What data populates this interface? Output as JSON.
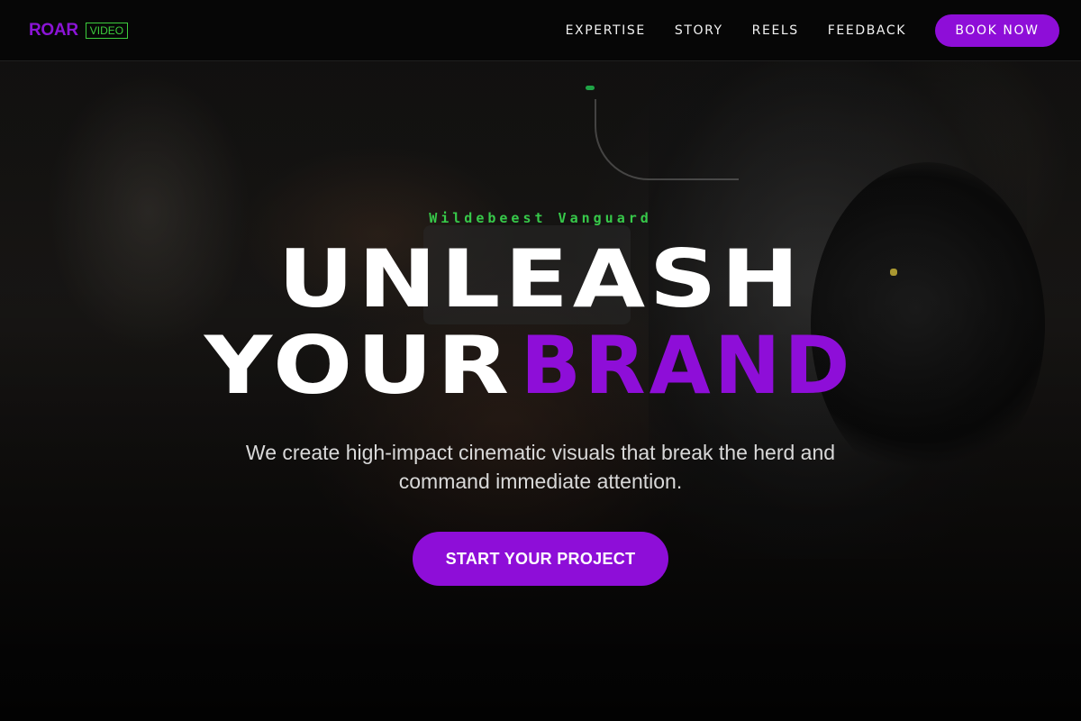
{
  "nav": {
    "logo_word": "ROAR",
    "logo_tag": "VIDEO",
    "links": [
      "EXPERTISE",
      "STORY",
      "REELS",
      "FEEDBACK"
    ],
    "cta_label": "BOOK NOW"
  },
  "hero": {
    "eyebrow": "Wildebeest Vanguard",
    "headline_line1": "UNLEASH",
    "headline_line2_white": "YOUR",
    "headline_line2_accent": "BRAND",
    "subhead": "We create high-impact cinematic visuals that break the herd and command immediate attention.",
    "cta_label": "START YOUR PROJECT",
    "background_image": "video-camera-photo"
  },
  "colors": {
    "accent": "#8e0ed8",
    "eyebrow_green": "#37c94a",
    "logo_tag_green": "#3ccc3c"
  }
}
